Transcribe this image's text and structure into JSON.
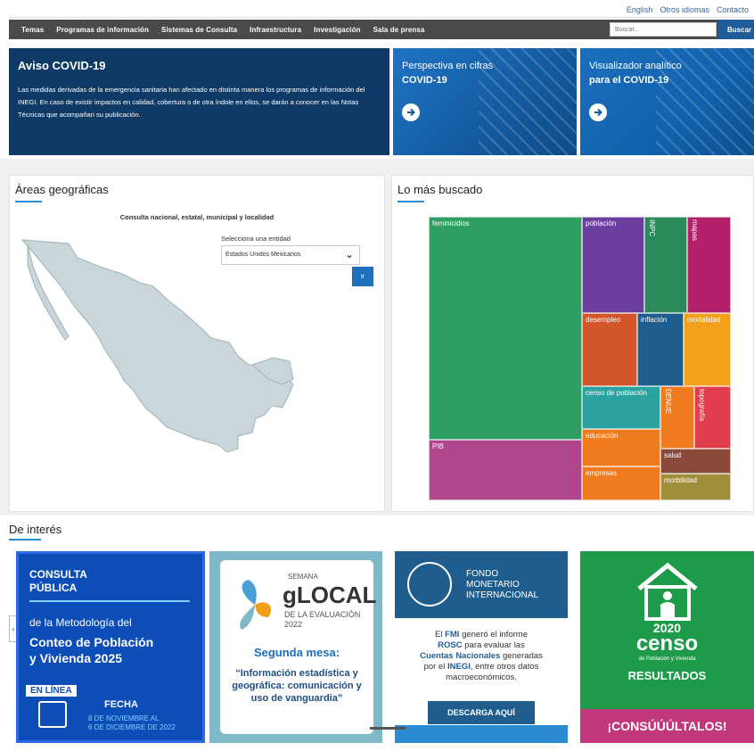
{
  "utility_links": [
    "English",
    "Otros idiomas",
    "Contacto"
  ],
  "nav": {
    "items": [
      "Temas",
      "Programas de información",
      "Sistemas de Consulta",
      "Infraestructura",
      "Investigación",
      "Sala de prensa"
    ],
    "search_placeholder": "Buscar...",
    "search_button": "Buscar"
  },
  "banners": {
    "covid": {
      "title": "Aviso COVID-19",
      "text": "Las medidas derivadas de la emergencia sanitaria han afectado en distinta manera los programas de información del INEGI. En caso de existir impactos en calidad, cobertura o de otra índole en ellos, se darán a conocer en las Notas Técnicas que acompañan su publicación."
    },
    "perspectiva": {
      "line1": "Perspectiva en cifras",
      "line2": "COVID-19"
    },
    "visualizador": {
      "line1": "Visualizador analítico",
      "line2": "para el COVID-19"
    }
  },
  "geo": {
    "title": "Áreas geográficas",
    "subtitle": "Consulta nacional, estatal, municipal y localidad",
    "select_label": "Selecciona una entidad",
    "select_value": "Estados Unidos Mexicanos",
    "go_button": "Ir"
  },
  "buscado": {
    "title": "Lo más buscado",
    "tiles": [
      {
        "label": "feminicidios",
        "color": "#2e9e62"
      },
      {
        "label": "población",
        "color": "#6b3fa0"
      },
      {
        "label": "INPC",
        "color": "#2a8a5a"
      },
      {
        "label": "mapas",
        "color": "#b3216a"
      },
      {
        "label": "desempleo",
        "color": "#d2562a"
      },
      {
        "label": "inflación",
        "color": "#1f5d8f"
      },
      {
        "label": "mortalidad",
        "color": "#f2a01a"
      },
      {
        "label": "censo de población",
        "color": "#2aa3a0"
      },
      {
        "label": "DENUE",
        "color": "#f07a1e"
      },
      {
        "label": "topografía",
        "color": "#e23c4f"
      },
      {
        "label": "PIB",
        "color": "#b0478e"
      },
      {
        "label": "educación",
        "color": "#f07a1e"
      },
      {
        "label": "salud",
        "color": "#8a4a3a"
      },
      {
        "label": "empresas",
        "color": "#f07a1e"
      },
      {
        "label": "morbilidad",
        "color": "#a08f3a"
      }
    ]
  },
  "interes": {
    "title": "De interés",
    "consulta": {
      "line1": "CONSULTA",
      "line2": "PÚBLICA",
      "line3": "de la Metodología del",
      "line4": "Conteo de Población",
      "line5": "y Vivienda 2025",
      "badge": "EN LÍNEA",
      "fecha": "FECHA",
      "dates1": "8 DE NOVIEMBRE AL",
      "dates2": "6 DE DICIEMBRE DE 2022"
    },
    "glocal": {
      "semana": "SEMANA",
      "name": "gLOCAL",
      "de": "DE LA EVALUACIÓN",
      "year": "2022",
      "mesa": "Segunda mesa:",
      "quote": "“Información estadística y geográfica: comunicación y uso de vanguardia”"
    },
    "fmi": {
      "org1": "FONDO",
      "org2": "MONETARIO",
      "org3": "INTERNACIONAL",
      "t1": "El ",
      "t_fmi": "FMI",
      "t2": " generó el informe",
      "t_rosc": "ROSC",
      "t3": " para evaluar las",
      "t_cuentas": "Cuentas Nacionales",
      "t4": " generadas",
      "t5": "por el ",
      "t_inegi": "INEGI",
      "t6": ", entre otros datos",
      "t7": "macroeconómicos.",
      "button": "DESCARGA AQUÍ"
    },
    "censo": {
      "year": "2020",
      "name": "censo",
      "sub": "de Población y Vivienda",
      "res": "RESULTADOS",
      "cta": "¡CONSÚÚÚLTALOS!"
    }
  }
}
